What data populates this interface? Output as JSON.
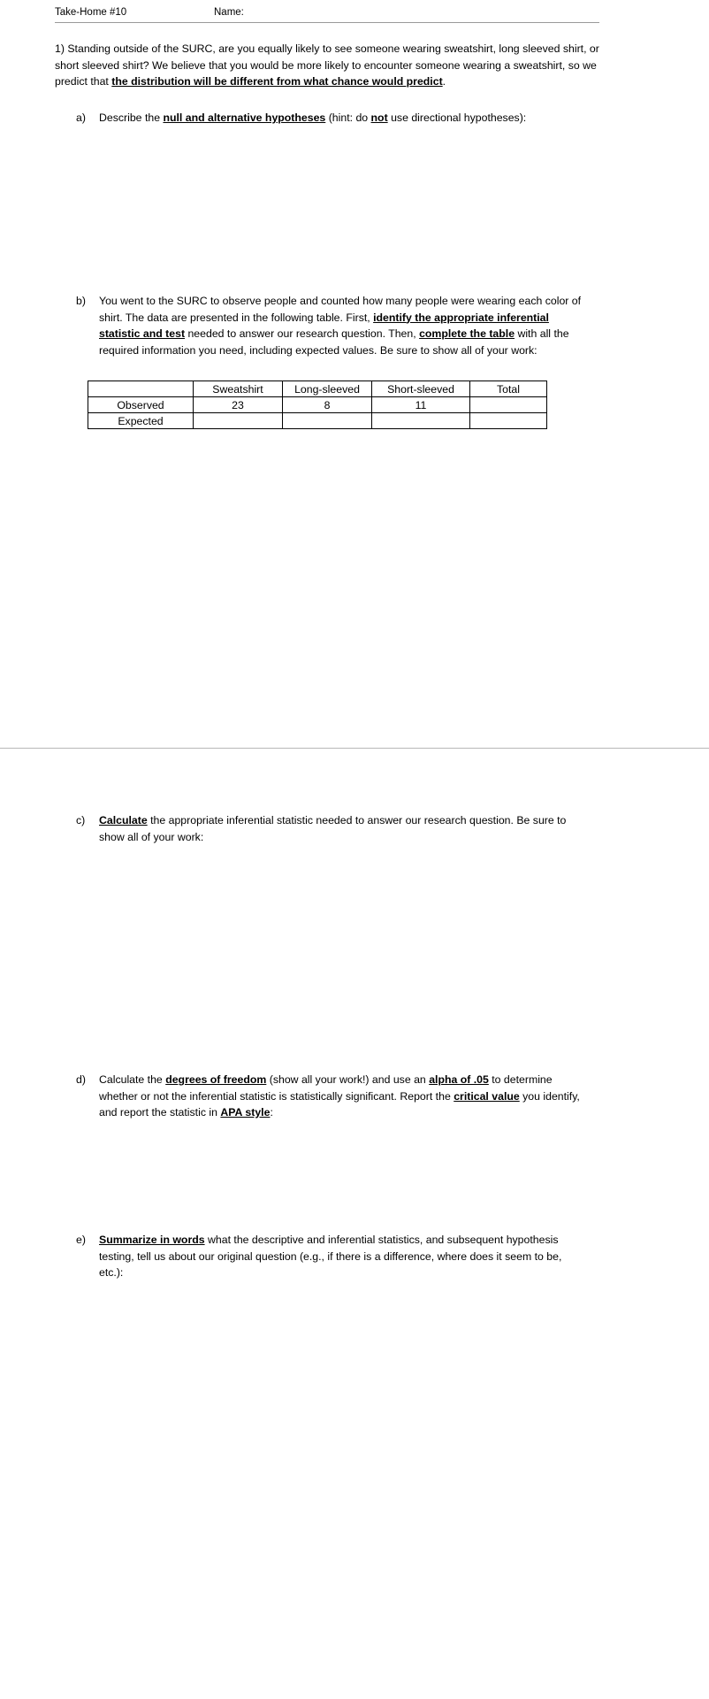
{
  "header": {
    "assignment_label": "Take-Home #10",
    "name_label": "Name:"
  },
  "question": {
    "number": "1)",
    "intro_part1": "Standing outside of the SURC, are you equally likely to see someone wearing sweatshirt, long sleeved shirt, or short sleeved shirt? We believe that you would be more likely to encounter someone wearing a sweatshirt, so we predict that ",
    "intro_emphasis": "the distribution will be different from what chance would predict",
    "intro_part2": "."
  },
  "parts": {
    "a": {
      "marker": "a)",
      "text1": "Describe the ",
      "em1": "null and alternative hypotheses",
      "text2": " (hint: do ",
      "em2": "not",
      "text3": " use directional hypotheses):"
    },
    "b": {
      "marker": "b)",
      "text1": "You went to the SURC to observe people and counted how many people were wearing each color of shirt. The data are presented in the following table. First, ",
      "em1": "identify the appropriate inferential statistic and test",
      "text2": " needed to answer our research question. Then, ",
      "em2": "complete the table",
      "text3": " with all the required information you need, including expected values. Be sure to show all of your work:"
    },
    "c": {
      "marker": "c)",
      "em1": "Calculate",
      "text1": " the appropriate inferential statistic needed to answer our research question. Be sure to show all of your work:"
    },
    "d": {
      "marker": "d)",
      "text1": "Calculate the ",
      "em1": "degrees of freedom",
      "text2": " (show all your work!) and use an ",
      "em2": "alpha of .05",
      "text3": " to determine whether or not the inferential statistic is statistically significant. Report the ",
      "em3": "critical value",
      "text4": " you identify, and report the statistic in ",
      "em4": "APA style",
      "text5": ":"
    },
    "e": {
      "marker": "e)",
      "em1": "Summarize in words",
      "text1": " what the descriptive and inferential statistics, and subsequent hypothesis testing, tell us about our original question (e.g., if there is a difference, where does it seem to be, etc.):"
    }
  },
  "table": {
    "headers": [
      "",
      "Sweatshirt",
      "Long-sleeved",
      "Short-sleeved",
      "Total"
    ],
    "rows": [
      {
        "label": "Observed",
        "sweatshirt": "23",
        "long_sleeved": "8",
        "short_sleeved": "11",
        "total": ""
      },
      {
        "label": "Expected",
        "sweatshirt": "",
        "long_sleeved": "",
        "short_sleeved": "",
        "total": ""
      }
    ]
  }
}
